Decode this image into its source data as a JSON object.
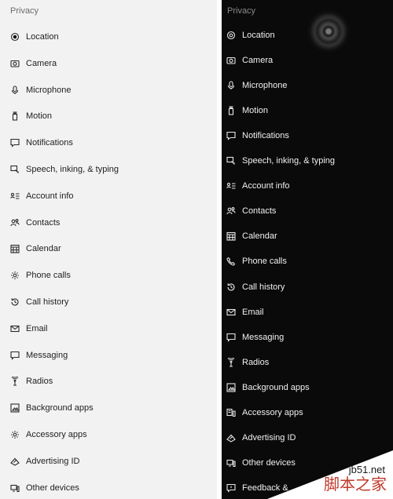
{
  "light": {
    "header": "Privacy",
    "items": [
      {
        "label": "Location",
        "icon": "location-icon"
      },
      {
        "label": "Camera",
        "icon": "camera-icon"
      },
      {
        "label": "Microphone",
        "icon": "microphone-icon"
      },
      {
        "label": "Motion",
        "icon": "motion-icon"
      },
      {
        "label": "Notifications",
        "icon": "notifications-icon"
      },
      {
        "label": "Speech, inking, & typing",
        "icon": "speech-icon"
      },
      {
        "label": "Account info",
        "icon": "account-info-icon"
      },
      {
        "label": "Contacts",
        "icon": "contacts-icon"
      },
      {
        "label": "Calendar",
        "icon": "calendar-icon"
      },
      {
        "label": "Phone calls",
        "icon": "gear-icon"
      },
      {
        "label": "Call history",
        "icon": "history-icon"
      },
      {
        "label": "Email",
        "icon": "email-icon"
      },
      {
        "label": "Messaging",
        "icon": "messaging-icon"
      },
      {
        "label": "Radios",
        "icon": "radios-icon"
      },
      {
        "label": "Background apps",
        "icon": "background-apps-icon"
      },
      {
        "label": "Accessory apps",
        "icon": "gear-icon"
      },
      {
        "label": "Advertising ID",
        "icon": "advertising-icon"
      },
      {
        "label": "Other devices",
        "icon": "devices-icon"
      }
    ]
  },
  "dark": {
    "header": "Privacy",
    "items": [
      {
        "label": "Location",
        "icon": "location-icon"
      },
      {
        "label": "Camera",
        "icon": "camera-icon"
      },
      {
        "label": "Microphone",
        "icon": "microphone-icon"
      },
      {
        "label": "Motion",
        "icon": "motion-icon"
      },
      {
        "label": "Notifications",
        "icon": "notifications-icon"
      },
      {
        "label": "Speech, inking, & typing",
        "icon": "speech-icon"
      },
      {
        "label": "Account info",
        "icon": "account-info-icon"
      },
      {
        "label": "Contacts",
        "icon": "contacts-icon"
      },
      {
        "label": "Calendar",
        "icon": "calendar-icon"
      },
      {
        "label": "Phone calls",
        "icon": "phone-icon"
      },
      {
        "label": "Call history",
        "icon": "history-icon"
      },
      {
        "label": "Email",
        "icon": "email-icon"
      },
      {
        "label": "Messaging",
        "icon": "messaging-icon"
      },
      {
        "label": "Radios",
        "icon": "radios-icon"
      },
      {
        "label": "Background apps",
        "icon": "background-apps-icon"
      },
      {
        "label": "Accessory apps",
        "icon": "accessory-apps-icon"
      },
      {
        "label": "Advertising ID",
        "icon": "advertising-icon"
      },
      {
        "label": "Other devices",
        "icon": "devices-icon"
      },
      {
        "label": "Feedback &",
        "icon": "feedback-icon"
      }
    ]
  },
  "watermark": {
    "site": "jb51.net",
    "text": "脚本之家"
  }
}
